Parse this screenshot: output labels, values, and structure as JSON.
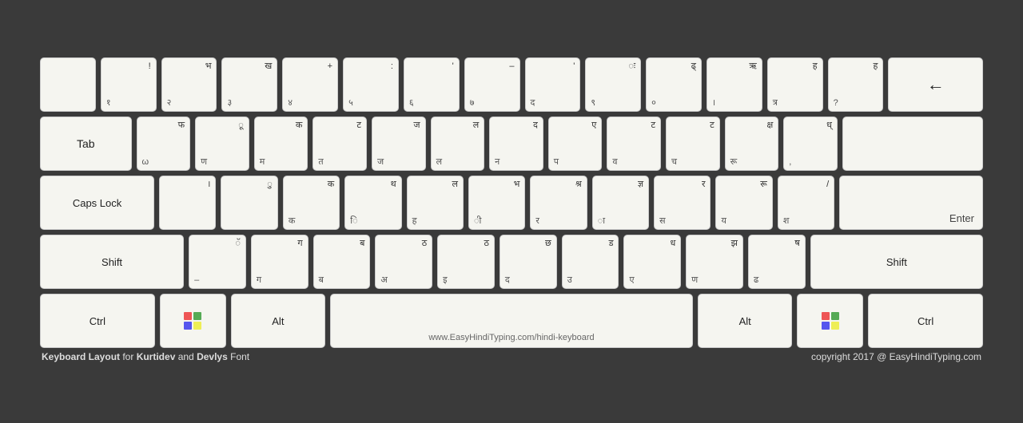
{
  "keyboard": {
    "rows": [
      {
        "id": "row1",
        "keys": [
          {
            "id": "tilde",
            "top": "",
            "bottom": "~",
            "main": ""
          },
          {
            "id": "1",
            "top": "!",
            "bottom": "१",
            "main": ""
          },
          {
            "id": "2",
            "top": "भ",
            "bottom": "२",
            "main": ""
          },
          {
            "id": "3",
            "top": "ख",
            "bottom": "३",
            "main": ""
          },
          {
            "id": "4",
            "top": "+",
            "bottom": "४",
            "main": ""
          },
          {
            "id": "5",
            "top": ":",
            "bottom": "५",
            "main": ""
          },
          {
            "id": "6",
            "top": "'",
            "bottom": "६",
            "main": ""
          },
          {
            "id": "7",
            "top": "–",
            "bottom": "७",
            "main": ""
          },
          {
            "id": "8",
            "top": "'",
            "bottom": "द",
            "main": ""
          },
          {
            "id": "9",
            "top": "ः",
            "bottom": "९",
            "main": ""
          },
          {
            "id": "0",
            "top": "ढ्",
            "bottom": "०",
            "main": ""
          },
          {
            "id": "minus",
            "top": "ऋ",
            "bottom": "।",
            "main": ""
          },
          {
            "id": "equal",
            "top": "ह",
            "bottom": "त्र",
            "main": ""
          },
          {
            "id": "backslash",
            "top": "ह",
            "bottom": "?",
            "main": ""
          },
          {
            "id": "backspace",
            "top": "",
            "bottom": "",
            "main": "←",
            "special": "backspace"
          }
        ]
      },
      {
        "id": "row2",
        "keys": [
          {
            "id": "tab",
            "top": "",
            "bottom": "Tab",
            "main": "",
            "special": "tab"
          },
          {
            "id": "q",
            "top": "फ",
            "bottom": "ω",
            "main": ""
          },
          {
            "id": "w",
            "top": "ू",
            "bottom": "ण",
            "main": ""
          },
          {
            "id": "e",
            "top": "क",
            "bottom": "म",
            "main": ""
          },
          {
            "id": "r",
            "top": "ट",
            "bottom": "त",
            "main": ""
          },
          {
            "id": "t",
            "top": "ज",
            "bottom": "ज",
            "main": ""
          },
          {
            "id": "y",
            "top": "ल",
            "bottom": "ल",
            "main": ""
          },
          {
            "id": "u",
            "top": "द",
            "bottom": "न",
            "main": ""
          },
          {
            "id": "i",
            "top": "ए",
            "bottom": "प",
            "main": ""
          },
          {
            "id": "o",
            "top": "ट",
            "bottom": "व",
            "main": ""
          },
          {
            "id": "p",
            "top": "ट",
            "bottom": "च",
            "main": ""
          },
          {
            "id": "lbracket",
            "top": "क्ष",
            "bottom": "रू",
            "main": ""
          },
          {
            "id": "rbracket",
            "top": "ध",
            "bottom": ",",
            "main": ""
          },
          {
            "id": "enter",
            "top": "",
            "bottom": "",
            "main": "",
            "special": "enter"
          }
        ]
      },
      {
        "id": "row3",
        "keys": [
          {
            "id": "caps",
            "top": "",
            "bottom": "Caps Lock",
            "main": "",
            "special": "caps"
          },
          {
            "id": "a",
            "top": "।",
            "bottom": "",
            "main": ""
          },
          {
            "id": "s",
            "top": "ु",
            "bottom": "",
            "main": ""
          },
          {
            "id": "d",
            "top": "क",
            "bottom": "क",
            "main": ""
          },
          {
            "id": "f",
            "top": "थ",
            "bottom": "ि",
            "main": ""
          },
          {
            "id": "g",
            "top": "ल",
            "bottom": "ह",
            "main": ""
          },
          {
            "id": "h",
            "top": "भ",
            "bottom": "ी",
            "main": ""
          },
          {
            "id": "j",
            "top": "श्र",
            "bottom": "र",
            "main": ""
          },
          {
            "id": "k",
            "top": "ज्ञ",
            "bottom": "ा",
            "main": ""
          },
          {
            "id": "l",
            "top": "र",
            "bottom": "स",
            "main": ""
          },
          {
            "id": "semi",
            "top": "रू",
            "bottom": "य",
            "main": ""
          },
          {
            "id": "quote",
            "top": "/",
            "bottom": "श",
            "main": ""
          },
          {
            "id": "enter2",
            "top": "",
            "bottom": "Enter",
            "main": "",
            "special": "enter2"
          }
        ]
      },
      {
        "id": "row4",
        "keys": [
          {
            "id": "shift-l",
            "top": "",
            "bottom": "Shift",
            "main": "",
            "special": "shift-l"
          },
          {
            "id": "z",
            "top": "ॅ",
            "bottom": "–",
            "main": ""
          },
          {
            "id": "x",
            "top": "ग",
            "bottom": "ग",
            "main": ""
          },
          {
            "id": "c",
            "top": "ब",
            "bottom": "ब",
            "main": ""
          },
          {
            "id": "v",
            "top": "ठ",
            "bottom": "अ",
            "main": ""
          },
          {
            "id": "b",
            "top": "ठ",
            "bottom": "इ",
            "main": ""
          },
          {
            "id": "n",
            "top": "छ",
            "bottom": "द",
            "main": ""
          },
          {
            "id": "m",
            "top": "ड",
            "bottom": "उ",
            "main": ""
          },
          {
            "id": "comma",
            "top": "ध",
            "bottom": "ए",
            "main": ""
          },
          {
            "id": "period",
            "top": "झ",
            "bottom": "ण",
            "main": ""
          },
          {
            "id": "slash",
            "top": "ष",
            "bottom": "ढ",
            "main": ""
          },
          {
            "id": "shift-r",
            "top": "",
            "bottom": "Shift",
            "main": "",
            "special": "shift-r"
          }
        ]
      },
      {
        "id": "row5",
        "keys": [
          {
            "id": "ctrl-l",
            "top": "",
            "bottom": "Ctrl",
            "main": "",
            "special": "ctrl"
          },
          {
            "id": "win-l",
            "top": "",
            "bottom": "",
            "main": "win",
            "special": "win"
          },
          {
            "id": "alt-l",
            "top": "",
            "bottom": "Alt",
            "main": "",
            "special": "alt"
          },
          {
            "id": "space",
            "top": "",
            "bottom": "www.EasyHindiTyping.com/hindi-keyboard",
            "main": "",
            "special": "space"
          },
          {
            "id": "alt-r",
            "top": "",
            "bottom": "Alt",
            "main": "",
            "special": "alt"
          },
          {
            "id": "win-r",
            "top": "",
            "bottom": "",
            "main": "win",
            "special": "win"
          },
          {
            "id": "ctrl-r",
            "top": "",
            "bottom": "Ctrl",
            "main": "",
            "special": "ctrl"
          }
        ]
      }
    ],
    "footer": {
      "left": "Keyboard Layout for Kurtidev and Devlys Font",
      "right": "copyright 2017 @ EasyHindiTyping.com"
    }
  }
}
